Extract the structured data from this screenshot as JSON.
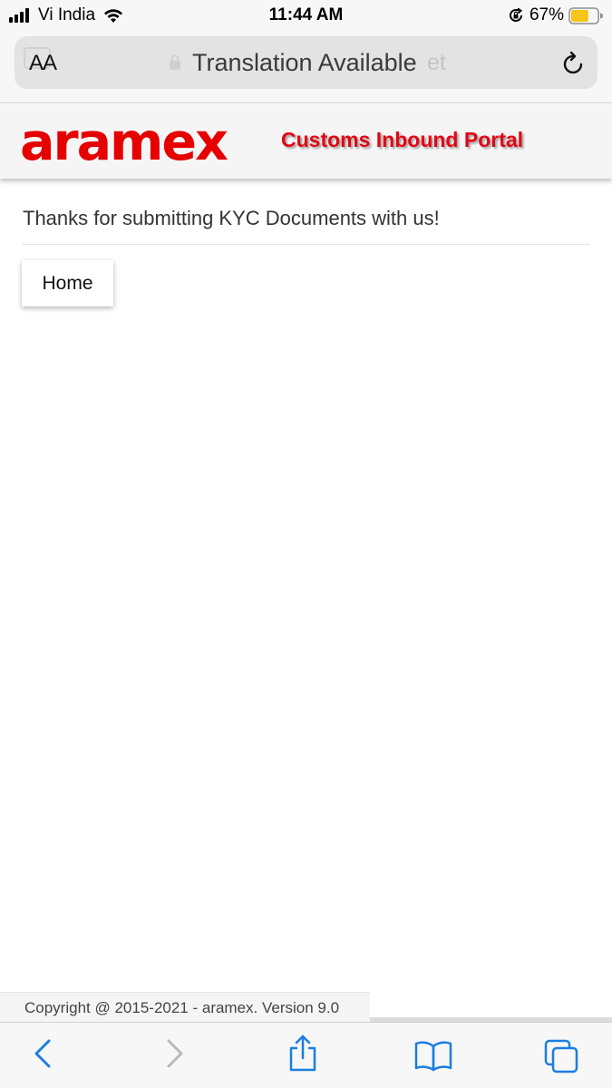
{
  "status_bar": {
    "carrier": "Vi India",
    "time": "11:44 AM",
    "battery_percent": "67%",
    "battery_level": 0.67,
    "battery_color": "#f5c518",
    "icons": [
      "signal-icon",
      "wifi-icon",
      "orientation-lock-icon",
      "battery-icon"
    ]
  },
  "address_bar": {
    "reader_label": "AA",
    "url_text": "Translation Available",
    "url_ghost": "et",
    "icons": [
      "translate-icon",
      "lock-icon",
      "reload-icon"
    ]
  },
  "header": {
    "logo_text": "aramex",
    "portal_title": "Customs Inbound Portal",
    "brand_color": "#e60000"
  },
  "content": {
    "message": "Thanks for submitting KYC Documents with us!",
    "home_button": "Home"
  },
  "footer": {
    "copyright": "Copyright @ 2015-2021 - aramex. Version 9.0"
  },
  "toolbar": {
    "icons": [
      "back-icon",
      "forward-icon",
      "share-icon",
      "bookmarks-icon",
      "tabs-icon"
    ],
    "accent_color": "#1a7fe0"
  }
}
